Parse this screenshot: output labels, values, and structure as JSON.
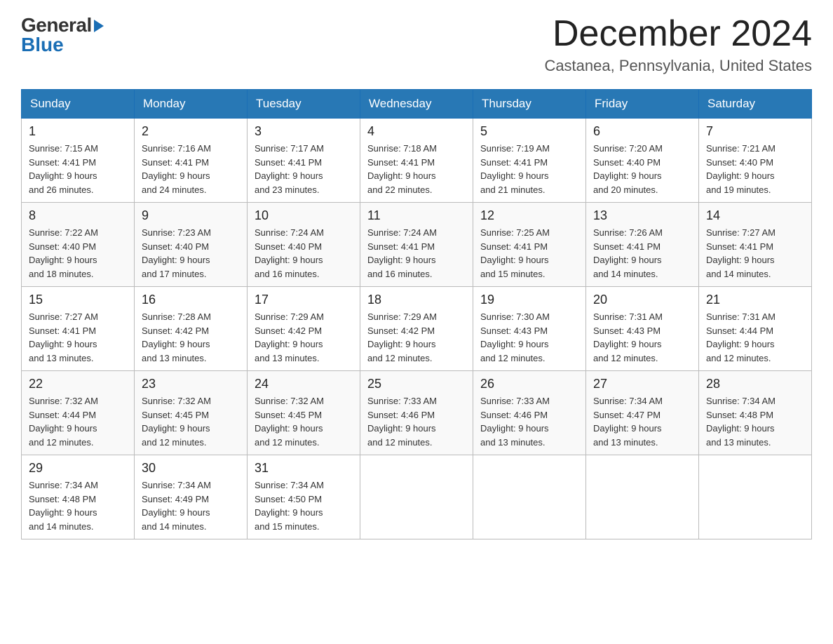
{
  "header": {
    "logo_general": "General",
    "logo_blue": "Blue",
    "month_title": "December 2024",
    "location": "Castanea, Pennsylvania, United States"
  },
  "days_of_week": [
    "Sunday",
    "Monday",
    "Tuesday",
    "Wednesday",
    "Thursday",
    "Friday",
    "Saturday"
  ],
  "weeks": [
    [
      {
        "day": "1",
        "sunrise": "7:15 AM",
        "sunset": "4:41 PM",
        "daylight": "9 hours and 26 minutes."
      },
      {
        "day": "2",
        "sunrise": "7:16 AM",
        "sunset": "4:41 PM",
        "daylight": "9 hours and 24 minutes."
      },
      {
        "day": "3",
        "sunrise": "7:17 AM",
        "sunset": "4:41 PM",
        "daylight": "9 hours and 23 minutes."
      },
      {
        "day": "4",
        "sunrise": "7:18 AM",
        "sunset": "4:41 PM",
        "daylight": "9 hours and 22 minutes."
      },
      {
        "day": "5",
        "sunrise": "7:19 AM",
        "sunset": "4:41 PM",
        "daylight": "9 hours and 21 minutes."
      },
      {
        "day": "6",
        "sunrise": "7:20 AM",
        "sunset": "4:40 PM",
        "daylight": "9 hours and 20 minutes."
      },
      {
        "day": "7",
        "sunrise": "7:21 AM",
        "sunset": "4:40 PM",
        "daylight": "9 hours and 19 minutes."
      }
    ],
    [
      {
        "day": "8",
        "sunrise": "7:22 AM",
        "sunset": "4:40 PM",
        "daylight": "9 hours and 18 minutes."
      },
      {
        "day": "9",
        "sunrise": "7:23 AM",
        "sunset": "4:40 PM",
        "daylight": "9 hours and 17 minutes."
      },
      {
        "day": "10",
        "sunrise": "7:24 AM",
        "sunset": "4:40 PM",
        "daylight": "9 hours and 16 minutes."
      },
      {
        "day": "11",
        "sunrise": "7:24 AM",
        "sunset": "4:41 PM",
        "daylight": "9 hours and 16 minutes."
      },
      {
        "day": "12",
        "sunrise": "7:25 AM",
        "sunset": "4:41 PM",
        "daylight": "9 hours and 15 minutes."
      },
      {
        "day": "13",
        "sunrise": "7:26 AM",
        "sunset": "4:41 PM",
        "daylight": "9 hours and 14 minutes."
      },
      {
        "day": "14",
        "sunrise": "7:27 AM",
        "sunset": "4:41 PM",
        "daylight": "9 hours and 14 minutes."
      }
    ],
    [
      {
        "day": "15",
        "sunrise": "7:27 AM",
        "sunset": "4:41 PM",
        "daylight": "9 hours and 13 minutes."
      },
      {
        "day": "16",
        "sunrise": "7:28 AM",
        "sunset": "4:42 PM",
        "daylight": "9 hours and 13 minutes."
      },
      {
        "day": "17",
        "sunrise": "7:29 AM",
        "sunset": "4:42 PM",
        "daylight": "9 hours and 13 minutes."
      },
      {
        "day": "18",
        "sunrise": "7:29 AM",
        "sunset": "4:42 PM",
        "daylight": "9 hours and 12 minutes."
      },
      {
        "day": "19",
        "sunrise": "7:30 AM",
        "sunset": "4:43 PM",
        "daylight": "9 hours and 12 minutes."
      },
      {
        "day": "20",
        "sunrise": "7:31 AM",
        "sunset": "4:43 PM",
        "daylight": "9 hours and 12 minutes."
      },
      {
        "day": "21",
        "sunrise": "7:31 AM",
        "sunset": "4:44 PM",
        "daylight": "9 hours and 12 minutes."
      }
    ],
    [
      {
        "day": "22",
        "sunrise": "7:32 AM",
        "sunset": "4:44 PM",
        "daylight": "9 hours and 12 minutes."
      },
      {
        "day": "23",
        "sunrise": "7:32 AM",
        "sunset": "4:45 PM",
        "daylight": "9 hours and 12 minutes."
      },
      {
        "day": "24",
        "sunrise": "7:32 AM",
        "sunset": "4:45 PM",
        "daylight": "9 hours and 12 minutes."
      },
      {
        "day": "25",
        "sunrise": "7:33 AM",
        "sunset": "4:46 PM",
        "daylight": "9 hours and 12 minutes."
      },
      {
        "day": "26",
        "sunrise": "7:33 AM",
        "sunset": "4:46 PM",
        "daylight": "9 hours and 13 minutes."
      },
      {
        "day": "27",
        "sunrise": "7:34 AM",
        "sunset": "4:47 PM",
        "daylight": "9 hours and 13 minutes."
      },
      {
        "day": "28",
        "sunrise": "7:34 AM",
        "sunset": "4:48 PM",
        "daylight": "9 hours and 13 minutes."
      }
    ],
    [
      {
        "day": "29",
        "sunrise": "7:34 AM",
        "sunset": "4:48 PM",
        "daylight": "9 hours and 14 minutes."
      },
      {
        "day": "30",
        "sunrise": "7:34 AM",
        "sunset": "4:49 PM",
        "daylight": "9 hours and 14 minutes."
      },
      {
        "day": "31",
        "sunrise": "7:34 AM",
        "sunset": "4:50 PM",
        "daylight": "9 hours and 15 minutes."
      },
      null,
      null,
      null,
      null
    ]
  ],
  "labels": {
    "sunrise": "Sunrise:",
    "sunset": "Sunset:",
    "daylight": "Daylight:"
  }
}
